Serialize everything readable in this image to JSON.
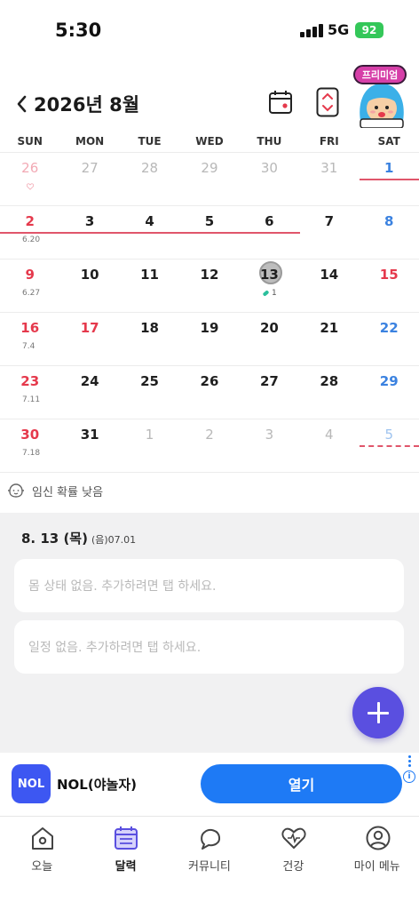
{
  "status_bar": {
    "time": "5:30",
    "network": "5G",
    "battery": "92"
  },
  "header": {
    "month_title": "2026년 8월",
    "premium_label": "프리미엄"
  },
  "weekdays": [
    "SUN",
    "MON",
    "TUE",
    "WED",
    "THU",
    "FRI",
    "SAT"
  ],
  "colors": {
    "accent": "#5a4fe0",
    "period": "#e0566b",
    "sunday": "#e5394c",
    "saturday": "#3b82e0",
    "ad_button": "#1e7af5"
  },
  "weeks": [
    {
      "days": [
        {
          "num": "26",
          "color": "pink",
          "mark": "heart"
        },
        {
          "num": "27",
          "color": "gray"
        },
        {
          "num": "28",
          "color": "gray"
        },
        {
          "num": "29",
          "color": "gray"
        },
        {
          "num": "30",
          "color": "gray"
        },
        {
          "num": "31",
          "color": "gray"
        },
        {
          "num": "1",
          "color": "blue"
        }
      ]
    },
    {
      "sub": "6.20",
      "days": [
        {
          "num": "2",
          "color": "red"
        },
        {
          "num": "3",
          "color": "dark"
        },
        {
          "num": "4",
          "color": "dark"
        },
        {
          "num": "5",
          "color": "dark"
        },
        {
          "num": "6",
          "color": "dark"
        },
        {
          "num": "7",
          "color": "dark"
        },
        {
          "num": "8",
          "color": "blue"
        }
      ]
    },
    {
      "sub": "6.27",
      "days": [
        {
          "num": "9",
          "color": "red"
        },
        {
          "num": "10",
          "color": "dark"
        },
        {
          "num": "11",
          "color": "dark"
        },
        {
          "num": "12",
          "color": "dark"
        },
        {
          "num": "13",
          "color": "dark",
          "today": true
        },
        {
          "num": "14",
          "color": "dark"
        },
        {
          "num": "15",
          "color": "red"
        }
      ]
    },
    {
      "sub": "7.4",
      "days": [
        {
          "num": "16",
          "color": "red"
        },
        {
          "num": "17",
          "color": "red"
        },
        {
          "num": "18",
          "color": "dark"
        },
        {
          "num": "19",
          "color": "dark"
        },
        {
          "num": "20",
          "color": "dark"
        },
        {
          "num": "21",
          "color": "dark"
        },
        {
          "num": "22",
          "color": "blue"
        }
      ]
    },
    {
      "sub": "7.11",
      "days": [
        {
          "num": "23",
          "color": "red"
        },
        {
          "num": "24",
          "color": "dark"
        },
        {
          "num": "25",
          "color": "dark"
        },
        {
          "num": "26",
          "color": "dark"
        },
        {
          "num": "27",
          "color": "dark"
        },
        {
          "num": "28",
          "color": "dark"
        },
        {
          "num": "29",
          "color": "blue"
        }
      ]
    },
    {
      "sub": "7.18",
      "days": [
        {
          "num": "30",
          "color": "red"
        },
        {
          "num": "31",
          "color": "dark"
        },
        {
          "num": "1",
          "color": "gray"
        },
        {
          "num": "2",
          "color": "gray"
        },
        {
          "num": "3",
          "color": "gray"
        },
        {
          "num": "4",
          "color": "gray"
        },
        {
          "num": "5",
          "color": "gray"
        }
      ]
    }
  ],
  "today_pill_count": "1",
  "pregnancy_note": "임신 확률 낮음",
  "detail": {
    "date": "8. 13 (목)",
    "lunar": "(음)07.01",
    "body_placeholder": "몸 상태 없음. 추가하려면 탭 하세요.",
    "schedule_placeholder": "일정 없음. 추가하려면 탭 하세요."
  },
  "ad": {
    "logo_text": "NOL",
    "name": "NOL(야놀자)",
    "open_label": "열기",
    "info_label": "i"
  },
  "tabs": [
    {
      "label": "오늘",
      "icon": "home-icon"
    },
    {
      "label": "달력",
      "icon": "calendar-icon",
      "active": true
    },
    {
      "label": "커뮤니티",
      "icon": "chat-icon"
    },
    {
      "label": "건강",
      "icon": "heart-pulse-icon"
    },
    {
      "label": "마이 메뉴",
      "icon": "profile-icon"
    }
  ]
}
